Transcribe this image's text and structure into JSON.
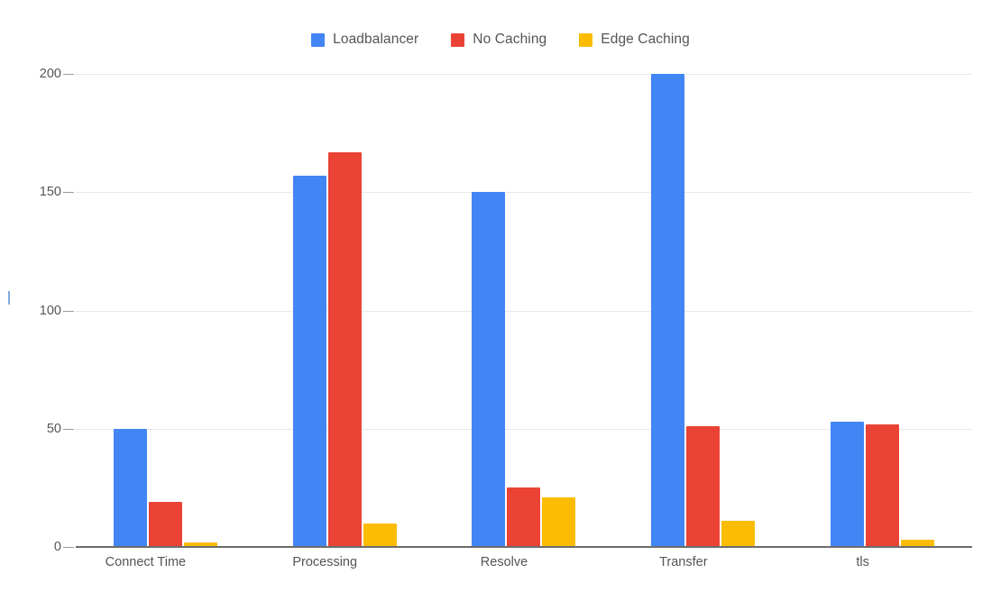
{
  "chart_data": {
    "type": "bar",
    "title": "",
    "subtitle": "",
    "xlabel": "",
    "ylabel": "",
    "categories": [
      "Connect Time",
      "Processing",
      "Resolve",
      "Transfer",
      "tls"
    ],
    "series": [
      {
        "name": "Loadbalancer",
        "color": "#4285F4",
        "values": [
          50,
          157,
          150,
          200,
          53
        ]
      },
      {
        "name": "No Caching",
        "color": "#EA4335",
        "values": [
          19,
          167,
          25,
          51,
          52
        ]
      },
      {
        "name": "Edge Caching",
        "color": "#FBBC04",
        "values": [
          2,
          10,
          21,
          11,
          3
        ]
      }
    ],
    "ylim": [
      0,
      200
    ],
    "yticks": [
      0,
      50,
      100,
      150,
      200
    ],
    "ytick_labels": [
      "0",
      "50",
      "100",
      "150",
      "200"
    ],
    "grid": true,
    "grid_axis": "y",
    "legend_position": "top-center",
    "background_color": "#FFFFFF",
    "grid_color": "#E8E8E8",
    "axis_color": "#6B6B6B",
    "label_color": "#555555"
  }
}
